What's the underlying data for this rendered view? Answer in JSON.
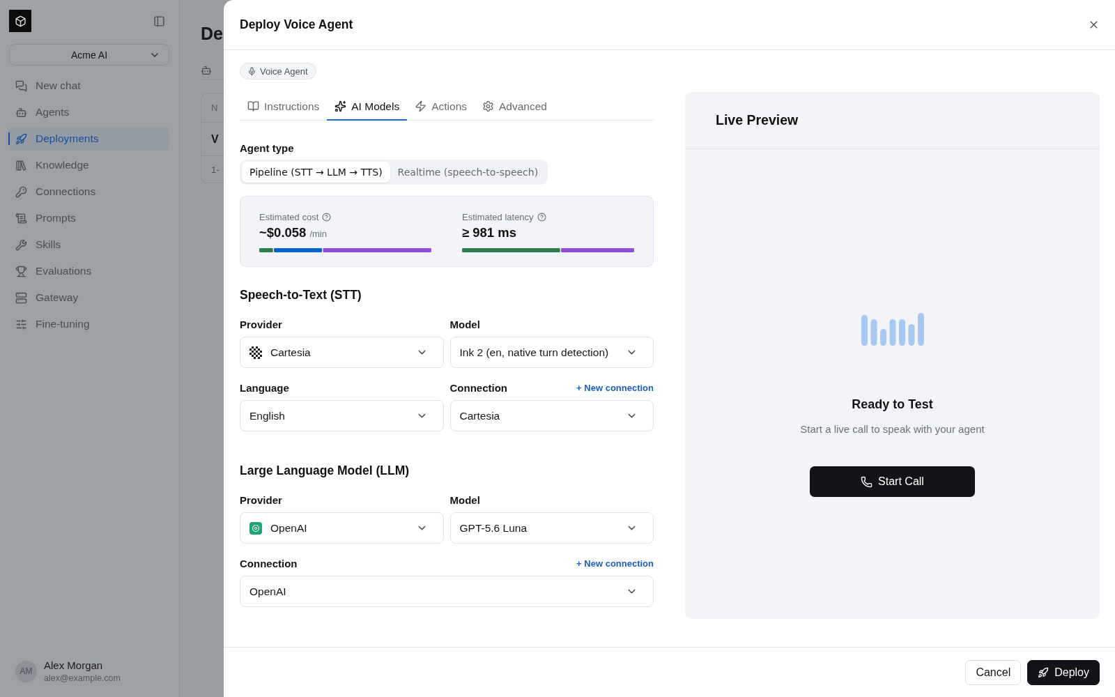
{
  "sidebar": {
    "workspace": "Acme AI",
    "items": [
      {
        "label": "New chat",
        "selected": false
      },
      {
        "label": "Agents",
        "selected": false
      },
      {
        "label": "Deployments",
        "selected": true
      },
      {
        "label": "Knowledge",
        "selected": false
      },
      {
        "label": "Connections",
        "selected": false
      },
      {
        "label": "Prompts",
        "selected": false
      },
      {
        "label": "Skills",
        "selected": false
      },
      {
        "label": "Evaluations",
        "selected": false
      },
      {
        "label": "Gateway",
        "selected": false
      },
      {
        "label": "Fine-tuning",
        "selected": false
      }
    ],
    "user": {
      "initials": "AM",
      "name": "Alex Morgan",
      "email": "alex@example.com"
    }
  },
  "background_page": {
    "title": "De",
    "table_header": "N",
    "row_title": "V",
    "footer": "1-"
  },
  "dialog": {
    "title": "Deploy Voice Agent",
    "badge": "Voice Agent",
    "tabs": [
      {
        "label": "Instructions",
        "selected": false
      },
      {
        "label": "AI Models",
        "selected": true
      },
      {
        "label": "Actions",
        "selected": false
      },
      {
        "label": "Advanced",
        "selected": false
      }
    ],
    "agent_type": {
      "label": "Agent type",
      "options": [
        {
          "label": "Pipeline (STT → LLM → TTS)",
          "selected": true
        },
        {
          "label": "Realtime (speech-to-speech)",
          "selected": false
        }
      ]
    },
    "estimates": [
      {
        "label": "Estimated cost",
        "value": "~$0.058",
        "unit": "/min"
      },
      {
        "label": "Estimated latency",
        "value": "≥ 981 ms"
      }
    ],
    "sections": [
      {
        "title": "Speech-to-Text (STT)",
        "fields": [
          {
            "label": "Provider",
            "value": "Cartesia",
            "full_width": false
          },
          {
            "label": "Model",
            "value": "Ink 2 (en, native turn detection)",
            "full_width": false
          },
          {
            "label": "Language",
            "value": "English",
            "full_width": false
          },
          {
            "label": "Connection",
            "value": "Cartesia",
            "action": "+ New connection",
            "full_width": false
          }
        ]
      },
      {
        "title": "Large Language Model (LLM)",
        "fields": [
          {
            "label": "Provider",
            "value": "OpenAI",
            "full_width": false
          },
          {
            "label": "Model",
            "value": "GPT-5.6 Luna",
            "full_width": false
          },
          {
            "label": "Connection",
            "value": "OpenAI",
            "action": "+ New connection",
            "full_width": true
          }
        ]
      }
    ],
    "preview": {
      "title": "Live Preview",
      "heading": "Ready to Test",
      "subtitle": "Start a live call to speak with your agent",
      "button": "Start Call"
    },
    "buttons": [
      {
        "label": "Cancel",
        "kind": "secondary"
      },
      {
        "label": "Deploy",
        "kind": "primary"
      }
    ]
  }
}
